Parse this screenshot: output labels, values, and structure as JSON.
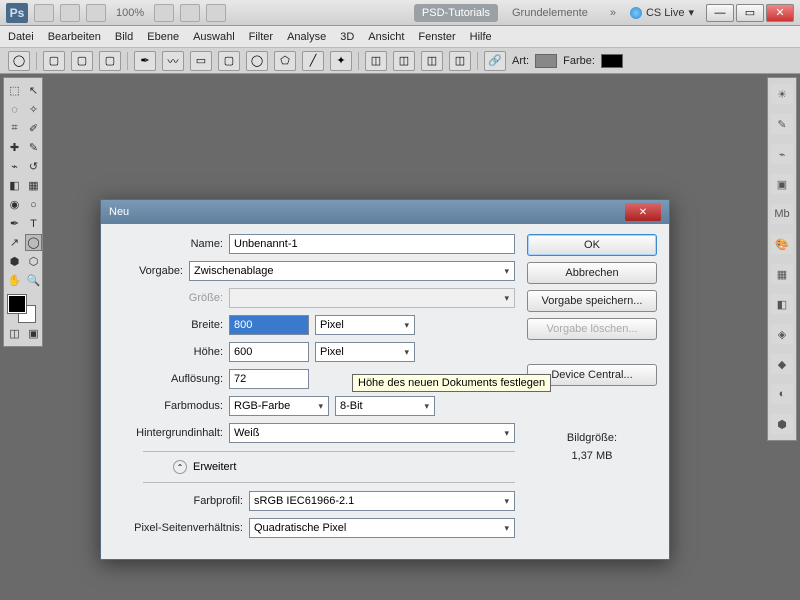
{
  "top": {
    "zoom": "100%",
    "live": "CS Live",
    "tab_active": "PSD-Tutorials",
    "tab2": "Grundelemente"
  },
  "menu": [
    "Datei",
    "Bearbeiten",
    "Bild",
    "Ebene",
    "Auswahl",
    "Filter",
    "Analyse",
    "3D",
    "Ansicht",
    "Fenster",
    "Hilfe"
  ],
  "opt": {
    "art": "Art:",
    "farbe": "Farbe:"
  },
  "dlg": {
    "title": "Neu",
    "name_lbl": "Name:",
    "name": "Unbenannt-1",
    "preset_lbl": "Vorgabe:",
    "preset": "Zwischenablage",
    "size_lbl": "Größe:",
    "width_lbl": "Breite:",
    "width": "800",
    "width_unit": "Pixel",
    "height_lbl": "Höhe:",
    "height": "600",
    "height_unit": "Pixel",
    "res_lbl": "Auflösung:",
    "res": "72",
    "mode_lbl": "Farbmodus:",
    "mode": "RGB-Farbe",
    "depth": "8-Bit",
    "bg_lbl": "Hintergrundinhalt:",
    "bg": "Weiß",
    "adv": "Erweitert",
    "profile_lbl": "Farbprofil:",
    "profile": "sRGB IEC61966-2.1",
    "par_lbl": "Pixel-Seitenverhältnis:",
    "par": "Quadratische Pixel",
    "ok": "OK",
    "cancel": "Abbrechen",
    "save": "Vorgabe speichern...",
    "del": "Vorgabe löschen...",
    "device": "Device Central...",
    "size_title": "Bildgröße:",
    "size_val": "1,37 MB"
  },
  "tooltip": "Höhe des neuen Dokuments festlegen"
}
